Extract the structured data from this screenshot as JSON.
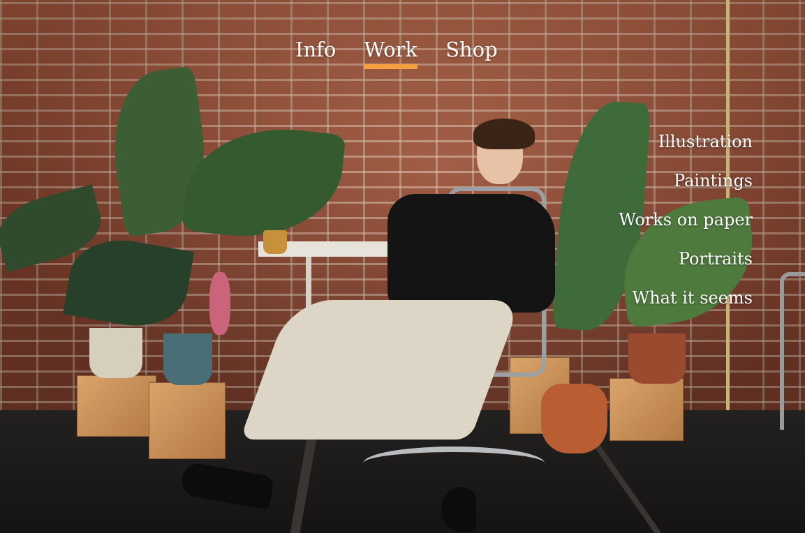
{
  "nav": {
    "items": [
      {
        "label": "Info",
        "active": false
      },
      {
        "label": "Work",
        "active": true
      },
      {
        "label": "Shop",
        "active": false
      }
    ],
    "active_underline_color": "#f2a040"
  },
  "work_menu": {
    "items": [
      {
        "label": "Illustration"
      },
      {
        "label": "Paintings"
      },
      {
        "label": "Works on paper"
      },
      {
        "label": "Portraits"
      },
      {
        "label": "What it seems"
      }
    ]
  },
  "background": {
    "description_icon": "hero-photo",
    "colors": {
      "wall": "#8a4a34",
      "floor": "#1a1717"
    }
  }
}
